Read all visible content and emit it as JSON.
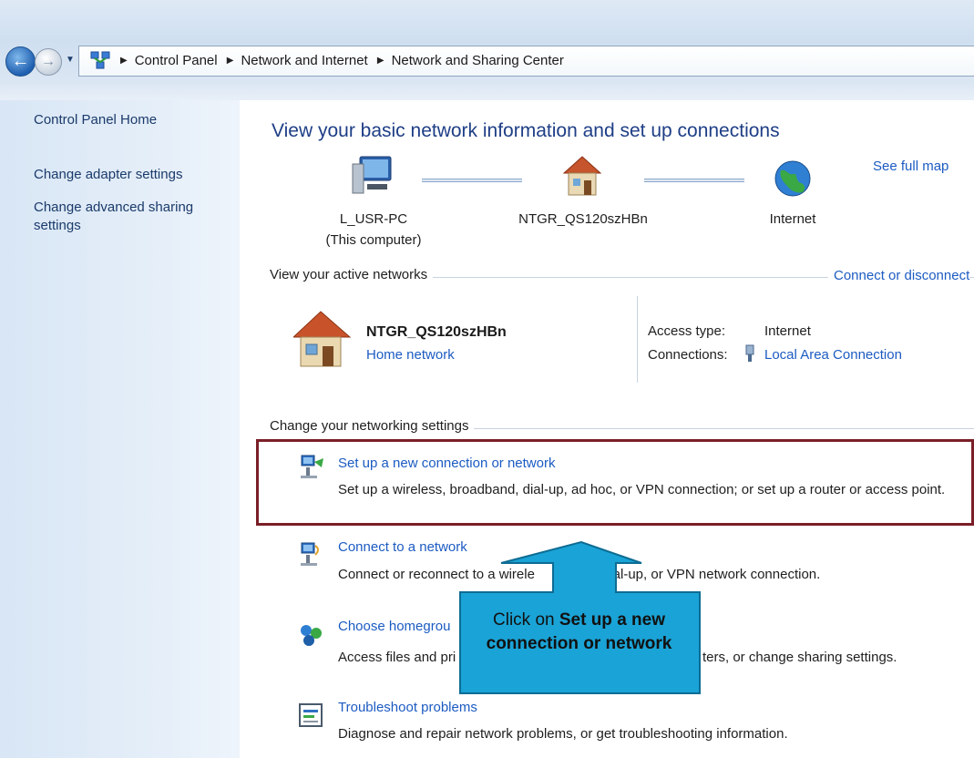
{
  "address_bar": {
    "breadcrumbs": [
      "Control Panel",
      "Network and Internet",
      "Network and Sharing Center"
    ]
  },
  "left_pane": {
    "links": [
      "Control Panel Home",
      "Change adapter settings",
      "Change advanced sharing settings"
    ]
  },
  "main": {
    "title": "View your basic network information and set up connections",
    "see_full_map": "See full map",
    "map_nodes": [
      {
        "name": "L_USR-PC",
        "sub": "(This computer)",
        "icon": "computer-icon"
      },
      {
        "name": "NTGR_QS120szHBn",
        "sub": "",
        "icon": "house-icon"
      },
      {
        "name": "Internet",
        "sub": "",
        "icon": "globe-icon"
      }
    ],
    "active_networks": {
      "heading": "View your active networks",
      "connect_link": "Connect or disconnect",
      "network_name": "NTGR_QS120szHBn",
      "network_type": "Home network",
      "access_type_label": "Access type:",
      "access_type_value": "Internet",
      "connections_label": "Connections:",
      "connections_value": "Local Area Connection"
    },
    "settings": {
      "heading": "Change your networking settings",
      "tasks": [
        {
          "title": "Set up a new connection or network",
          "desc": "Set up a wireless, broadband, dial-up, ad hoc, or VPN connection; or set up a router or access point."
        },
        {
          "title": "Connect to a network",
          "desc_left": "Connect or reconnect to a wirele",
          "desc_right": "dial-up, or VPN network connection."
        },
        {
          "title": "Choose homegrou",
          "desc_left": "Access files and pri",
          "desc_right": "ters, or change sharing settings."
        },
        {
          "title": "Troubleshoot problems",
          "desc": "Diagnose and repair network problems, or get troubleshooting information."
        }
      ]
    }
  },
  "callout": {
    "prefix": "Click on ",
    "bold_line1": "Set up a new",
    "bold_line2": "connection or network"
  },
  "colors": {
    "link": "#1c5bc2",
    "title": "#1e3e86",
    "highlight_border": "#7a1f27",
    "callout_fill": "#1aa3d6"
  }
}
